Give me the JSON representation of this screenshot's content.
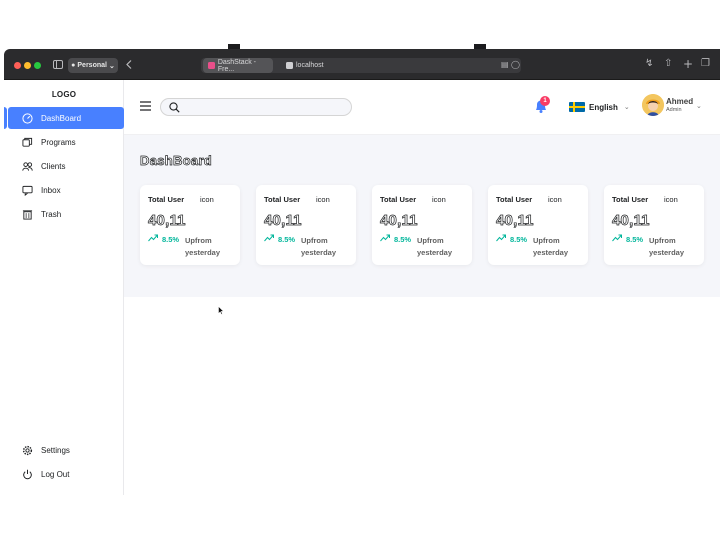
{
  "browser": {
    "profile_label": "Personal",
    "tabs": [
      {
        "label": "DashStack - Fre...",
        "favicon_color": "#e94f8a",
        "active": true
      },
      {
        "label": "localhost",
        "favicon_color": "#cfcfd2",
        "active": false
      }
    ],
    "traffic_lights": [
      "#ff5f57",
      "#febc2e",
      "#28c840"
    ]
  },
  "sidebar": {
    "logo": "LOGO",
    "items": [
      {
        "label": "DashBoard",
        "icon": "dashboard-gauge-icon",
        "active": true
      },
      {
        "label": "Programs",
        "icon": "layers-icon",
        "active": false
      },
      {
        "label": "Clients",
        "icon": "users-icon",
        "active": false
      },
      {
        "label": "Inbox",
        "icon": "inbox-icon",
        "active": false
      },
      {
        "label": "Trash",
        "icon": "trash-icon",
        "active": false
      }
    ],
    "bottom_items": [
      {
        "label": "Settings",
        "icon": "gear-icon"
      },
      {
        "label": "Log Out",
        "icon": "power-icon"
      }
    ]
  },
  "header": {
    "search_placeholder": "",
    "notification_count": "1",
    "language": "English",
    "user": {
      "name": "Ahmed",
      "role": "Admin"
    }
  },
  "main": {
    "title": "DashBoard",
    "cards": [
      {
        "title": "Total User",
        "icon_label": "icon",
        "value": "40,11",
        "change": "8.5%",
        "desc": "Upfrom yesterday"
      },
      {
        "title": "Total User",
        "icon_label": "icon",
        "value": "40,11",
        "change": "8.5%",
        "desc": "Upfrom yesterday"
      },
      {
        "title": "Total User",
        "icon_label": "icon",
        "value": "40,11",
        "change": "8.5%",
        "desc": "Upfrom yesterday"
      },
      {
        "title": "Total User",
        "icon_label": "icon",
        "value": "40,11",
        "change": "8.5%",
        "desc": "Upfrom yesterday"
      },
      {
        "title": "Total User",
        "icon_label": "icon",
        "value": "40,11",
        "change": "8.5%",
        "desc": "Upfrom yesterday"
      }
    ]
  },
  "colors": {
    "accent": "#4880ff",
    "positive": "#00b69b",
    "badge": "#f93c65",
    "background": "#f5f6fa"
  }
}
